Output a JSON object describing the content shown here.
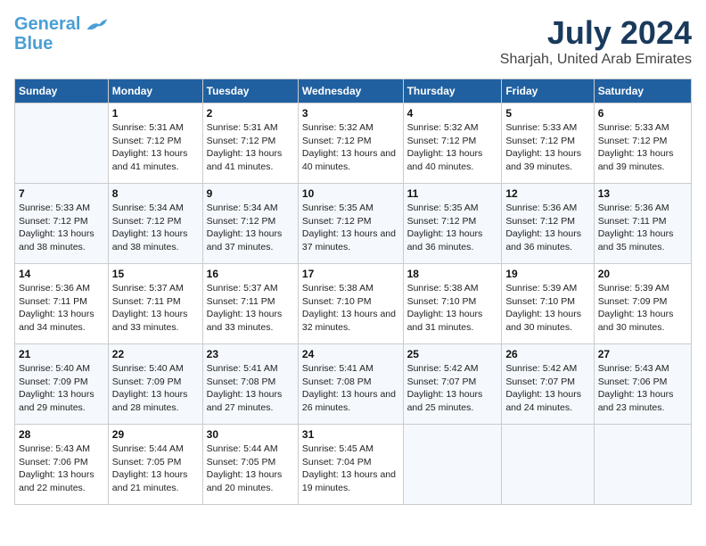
{
  "logo": {
    "line1": "General",
    "line2": "Blue"
  },
  "title": "July 2024",
  "subtitle": "Sharjah, United Arab Emirates",
  "headers": [
    "Sunday",
    "Monday",
    "Tuesday",
    "Wednesday",
    "Thursday",
    "Friday",
    "Saturday"
  ],
  "weeks": [
    [
      {
        "date": "",
        "sunrise": "",
        "sunset": "",
        "daylight": ""
      },
      {
        "date": "1",
        "sunrise": "Sunrise: 5:31 AM",
        "sunset": "Sunset: 7:12 PM",
        "daylight": "Daylight: 13 hours and 41 minutes."
      },
      {
        "date": "2",
        "sunrise": "Sunrise: 5:31 AM",
        "sunset": "Sunset: 7:12 PM",
        "daylight": "Daylight: 13 hours and 41 minutes."
      },
      {
        "date": "3",
        "sunrise": "Sunrise: 5:32 AM",
        "sunset": "Sunset: 7:12 PM",
        "daylight": "Daylight: 13 hours and 40 minutes."
      },
      {
        "date": "4",
        "sunrise": "Sunrise: 5:32 AM",
        "sunset": "Sunset: 7:12 PM",
        "daylight": "Daylight: 13 hours and 40 minutes."
      },
      {
        "date": "5",
        "sunrise": "Sunrise: 5:33 AM",
        "sunset": "Sunset: 7:12 PM",
        "daylight": "Daylight: 13 hours and 39 minutes."
      },
      {
        "date": "6",
        "sunrise": "Sunrise: 5:33 AM",
        "sunset": "Sunset: 7:12 PM",
        "daylight": "Daylight: 13 hours and 39 minutes."
      }
    ],
    [
      {
        "date": "7",
        "sunrise": "Sunrise: 5:33 AM",
        "sunset": "Sunset: 7:12 PM",
        "daylight": "Daylight: 13 hours and 38 minutes."
      },
      {
        "date": "8",
        "sunrise": "Sunrise: 5:34 AM",
        "sunset": "Sunset: 7:12 PM",
        "daylight": "Daylight: 13 hours and 38 minutes."
      },
      {
        "date": "9",
        "sunrise": "Sunrise: 5:34 AM",
        "sunset": "Sunset: 7:12 PM",
        "daylight": "Daylight: 13 hours and 37 minutes."
      },
      {
        "date": "10",
        "sunrise": "Sunrise: 5:35 AM",
        "sunset": "Sunset: 7:12 PM",
        "daylight": "Daylight: 13 hours and 37 minutes."
      },
      {
        "date": "11",
        "sunrise": "Sunrise: 5:35 AM",
        "sunset": "Sunset: 7:12 PM",
        "daylight": "Daylight: 13 hours and 36 minutes."
      },
      {
        "date": "12",
        "sunrise": "Sunrise: 5:36 AM",
        "sunset": "Sunset: 7:12 PM",
        "daylight": "Daylight: 13 hours and 36 minutes."
      },
      {
        "date": "13",
        "sunrise": "Sunrise: 5:36 AM",
        "sunset": "Sunset: 7:11 PM",
        "daylight": "Daylight: 13 hours and 35 minutes."
      }
    ],
    [
      {
        "date": "14",
        "sunrise": "Sunrise: 5:36 AM",
        "sunset": "Sunset: 7:11 PM",
        "daylight": "Daylight: 13 hours and 34 minutes."
      },
      {
        "date": "15",
        "sunrise": "Sunrise: 5:37 AM",
        "sunset": "Sunset: 7:11 PM",
        "daylight": "Daylight: 13 hours and 33 minutes."
      },
      {
        "date": "16",
        "sunrise": "Sunrise: 5:37 AM",
        "sunset": "Sunset: 7:11 PM",
        "daylight": "Daylight: 13 hours and 33 minutes."
      },
      {
        "date": "17",
        "sunrise": "Sunrise: 5:38 AM",
        "sunset": "Sunset: 7:10 PM",
        "daylight": "Daylight: 13 hours and 32 minutes."
      },
      {
        "date": "18",
        "sunrise": "Sunrise: 5:38 AM",
        "sunset": "Sunset: 7:10 PM",
        "daylight": "Daylight: 13 hours and 31 minutes."
      },
      {
        "date": "19",
        "sunrise": "Sunrise: 5:39 AM",
        "sunset": "Sunset: 7:10 PM",
        "daylight": "Daylight: 13 hours and 30 minutes."
      },
      {
        "date": "20",
        "sunrise": "Sunrise: 5:39 AM",
        "sunset": "Sunset: 7:09 PM",
        "daylight": "Daylight: 13 hours and 30 minutes."
      }
    ],
    [
      {
        "date": "21",
        "sunrise": "Sunrise: 5:40 AM",
        "sunset": "Sunset: 7:09 PM",
        "daylight": "Daylight: 13 hours and 29 minutes."
      },
      {
        "date": "22",
        "sunrise": "Sunrise: 5:40 AM",
        "sunset": "Sunset: 7:09 PM",
        "daylight": "Daylight: 13 hours and 28 minutes."
      },
      {
        "date": "23",
        "sunrise": "Sunrise: 5:41 AM",
        "sunset": "Sunset: 7:08 PM",
        "daylight": "Daylight: 13 hours and 27 minutes."
      },
      {
        "date": "24",
        "sunrise": "Sunrise: 5:41 AM",
        "sunset": "Sunset: 7:08 PM",
        "daylight": "Daylight: 13 hours and 26 minutes."
      },
      {
        "date": "25",
        "sunrise": "Sunrise: 5:42 AM",
        "sunset": "Sunset: 7:07 PM",
        "daylight": "Daylight: 13 hours and 25 minutes."
      },
      {
        "date": "26",
        "sunrise": "Sunrise: 5:42 AM",
        "sunset": "Sunset: 7:07 PM",
        "daylight": "Daylight: 13 hours and 24 minutes."
      },
      {
        "date": "27",
        "sunrise": "Sunrise: 5:43 AM",
        "sunset": "Sunset: 7:06 PM",
        "daylight": "Daylight: 13 hours and 23 minutes."
      }
    ],
    [
      {
        "date": "28",
        "sunrise": "Sunrise: 5:43 AM",
        "sunset": "Sunset: 7:06 PM",
        "daylight": "Daylight: 13 hours and 22 minutes."
      },
      {
        "date": "29",
        "sunrise": "Sunrise: 5:44 AM",
        "sunset": "Sunset: 7:05 PM",
        "daylight": "Daylight: 13 hours and 21 minutes."
      },
      {
        "date": "30",
        "sunrise": "Sunrise: 5:44 AM",
        "sunset": "Sunset: 7:05 PM",
        "daylight": "Daylight: 13 hours and 20 minutes."
      },
      {
        "date": "31",
        "sunrise": "Sunrise: 5:45 AM",
        "sunset": "Sunset: 7:04 PM",
        "daylight": "Daylight: 13 hours and 19 minutes."
      },
      {
        "date": "",
        "sunrise": "",
        "sunset": "",
        "daylight": ""
      },
      {
        "date": "",
        "sunrise": "",
        "sunset": "",
        "daylight": ""
      },
      {
        "date": "",
        "sunrise": "",
        "sunset": "",
        "daylight": ""
      }
    ]
  ]
}
